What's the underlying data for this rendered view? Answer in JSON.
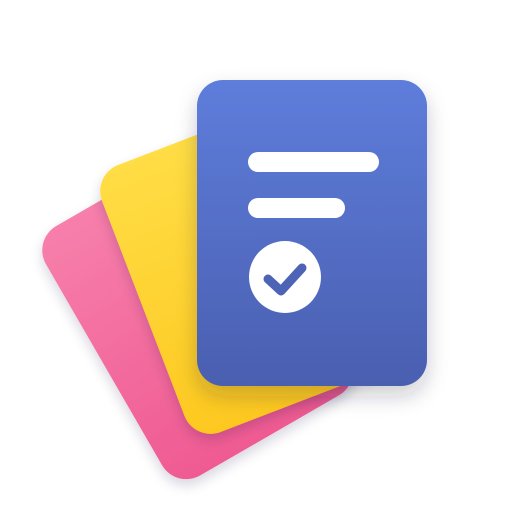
{
  "icon": {
    "name": "stacked-cards-checklist-icon",
    "colors": {
      "background": "#ffffff",
      "pink_card_top": "#f77fab",
      "pink_card_bottom": "#ef5a92",
      "yellow_card_top": "#ffdd45",
      "yellow_card_bottom": "#fdc81f",
      "blue_card_top": "#5e7ddb",
      "blue_card_bottom": "#4a5fb0",
      "foreground": "#ffffff",
      "check_mark": "#4d63b6",
      "shadow": "#1b1f3a"
    },
    "parts": {
      "back_card": "pink-card",
      "middle_card": "yellow-card",
      "front_card": "blue-document-card",
      "front_line_1": "long-text-line",
      "front_line_2": "short-text-line",
      "badge": "check-circle-icon"
    }
  }
}
